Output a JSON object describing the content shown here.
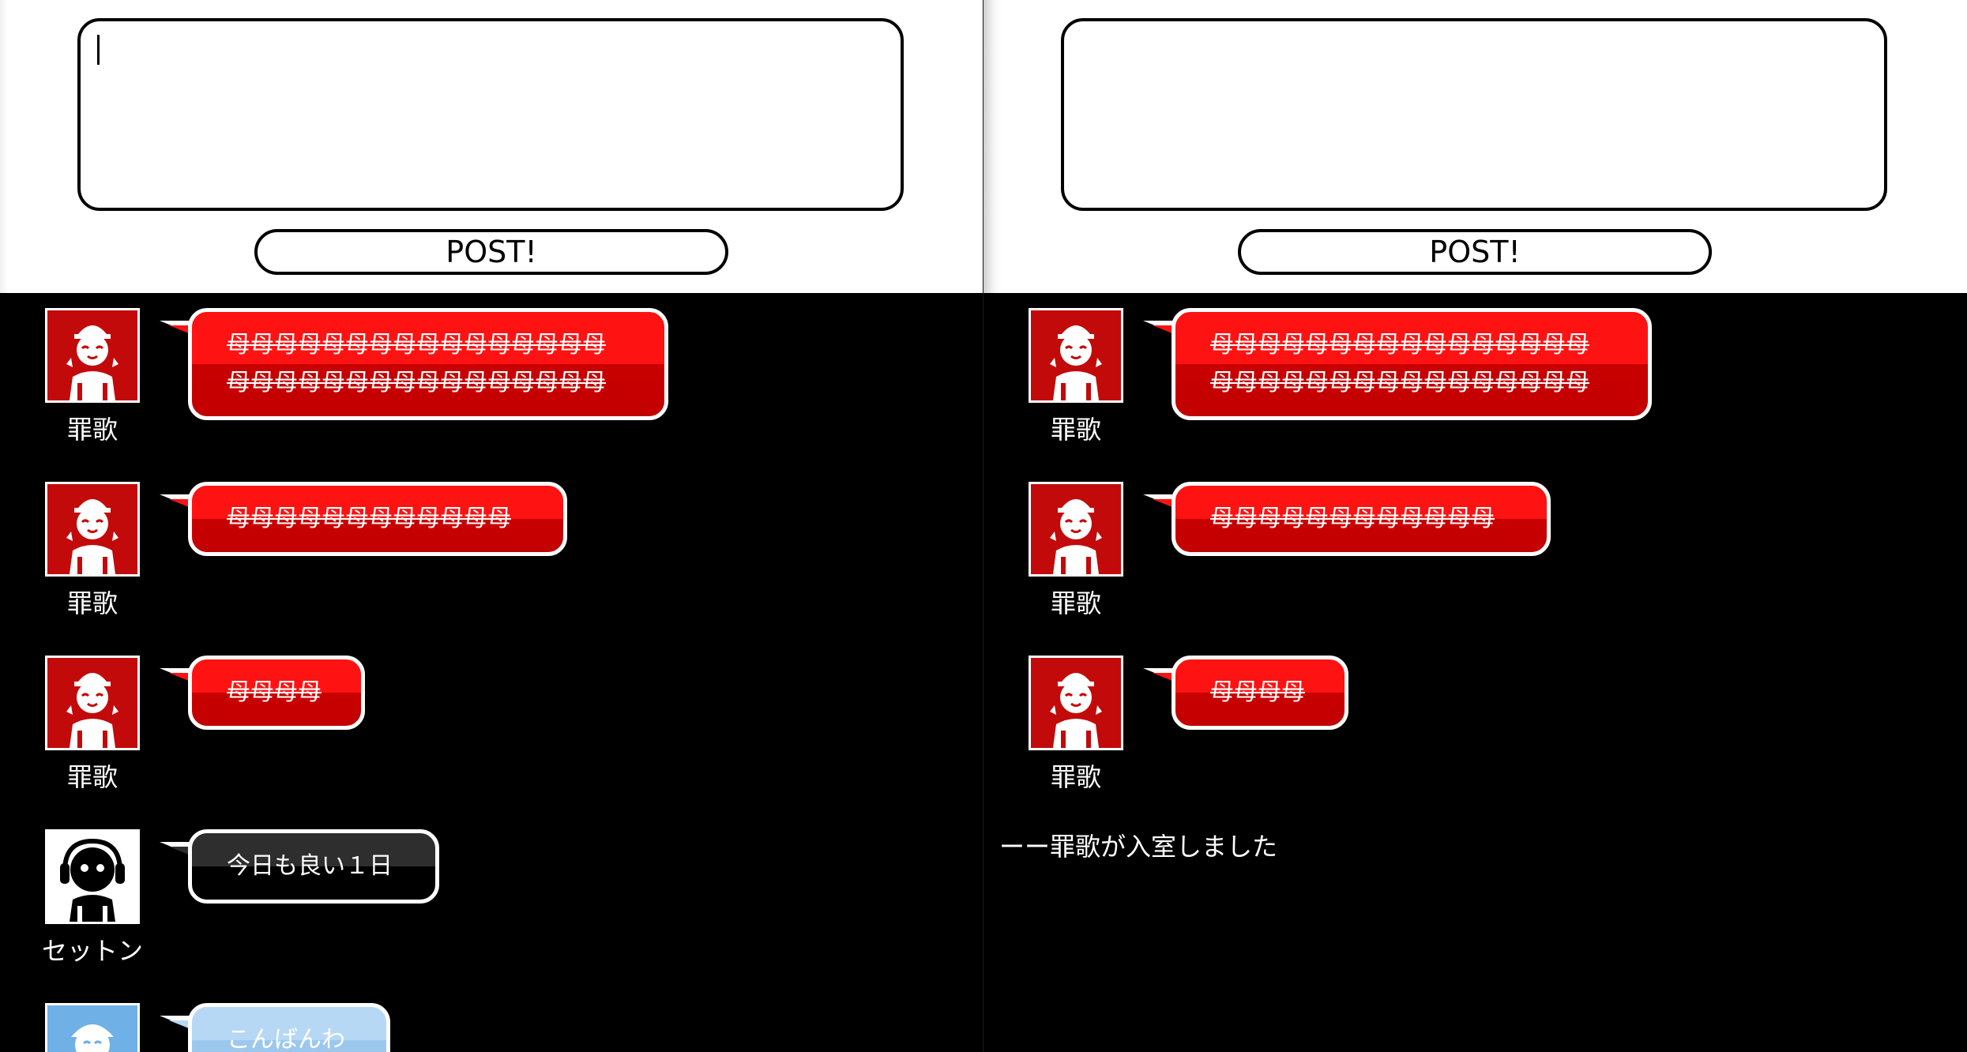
{
  "composer": {
    "post_button_label": "POST!"
  },
  "left_panel": {
    "messages": [
      {
        "user": "罪歌",
        "text": "母母母母母母母母母母母母母母母母 母母母母母母母母母母母母母母母母"
      },
      {
        "user": "罪歌",
        "text": "母母母母母母母母母母母母"
      },
      {
        "user": "罪歌",
        "text": "母母母母"
      },
      {
        "user": "セットン",
        "text": "今日も良い１日"
      },
      {
        "user": "",
        "text": "こんばんわ"
      }
    ]
  },
  "right_panel": {
    "messages": [
      {
        "user": "罪歌",
        "text": "母母母母母母母母母母母母母母母母 母母母母母母母母母母母母母母母母"
      },
      {
        "user": "罪歌",
        "text": "母母母母母母母母母母母母"
      },
      {
        "user": "罪歌",
        "text": "母母母母"
      }
    ],
    "system_message": "ーー罪歌が入室しました"
  },
  "colors": {
    "red_bubble": "#ff1212",
    "black_bubble": "#2e2e2e",
    "blue_bubble": "#b6d8f5"
  },
  "icons": {
    "saika_avatar": "girl-avatar-icon",
    "setton_avatar": "headphones-avatar-icon",
    "blue_avatar": "boy-avatar-icon"
  }
}
